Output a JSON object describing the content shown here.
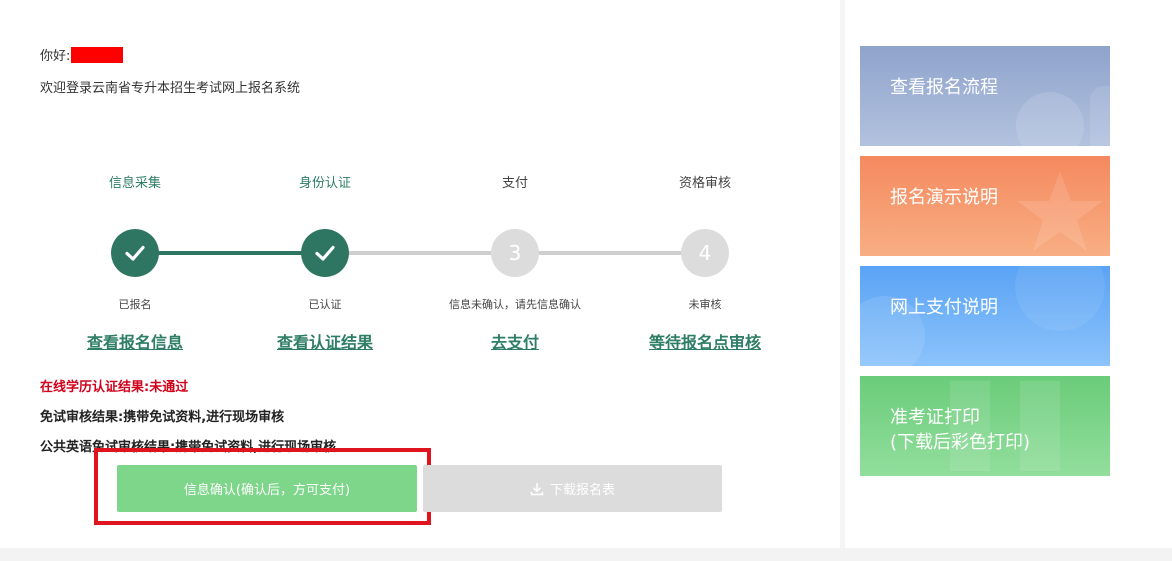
{
  "header": {
    "greeting": "你好:",
    "welcome": "欢迎登录云南省专升本招生考试网上报名系统"
  },
  "steps": [
    {
      "title": "信息采集",
      "symbol": "✓",
      "status": "已报名",
      "link": "查看报名信息",
      "state": "done"
    },
    {
      "title": "身份认证",
      "symbol": "✓",
      "status": "已认证",
      "link": "查看认证结果",
      "state": "done"
    },
    {
      "title": "支付",
      "symbol": "3",
      "status": "信息未确认，请先信息确认",
      "link": "去支付",
      "state": "todo"
    },
    {
      "title": "资格审核",
      "symbol": "4",
      "status": "未审核",
      "link": "等待报名点审核",
      "state": "todo"
    }
  ],
  "results": {
    "education_cert": "在线学历认证结果:未通过",
    "exemption": "免试审核结果:携带免试资料,进行现场审核",
    "english_exemption": "公共英语免试审核结果:携带免试资料,进行现场审核"
  },
  "buttons": {
    "confirm": "信息确认(确认后，方可支付)",
    "download": "下载报名表"
  },
  "side_cards": [
    {
      "line1": "查看报名流程",
      "line2": ""
    },
    {
      "line1": "报名演示说明",
      "line2": ""
    },
    {
      "line1": "网上支付说明",
      "line2": ""
    },
    {
      "line1": "准考证打印",
      "line2": "(下载后彩色打印)"
    }
  ],
  "colors": {
    "primary": "#2f7662",
    "error": "#d0021b",
    "confirm_button": "#7dd68a",
    "disabled_button": "#dcdcdc",
    "highlight_border": "#e0141e",
    "card_blue_gray": "#8fa3cc",
    "card_orange": "#f5895f",
    "card_blue": "#5aa3f5",
    "card_green": "#6acc7a"
  },
  "icons": {
    "done": "check-icon",
    "download": "download-icon"
  }
}
